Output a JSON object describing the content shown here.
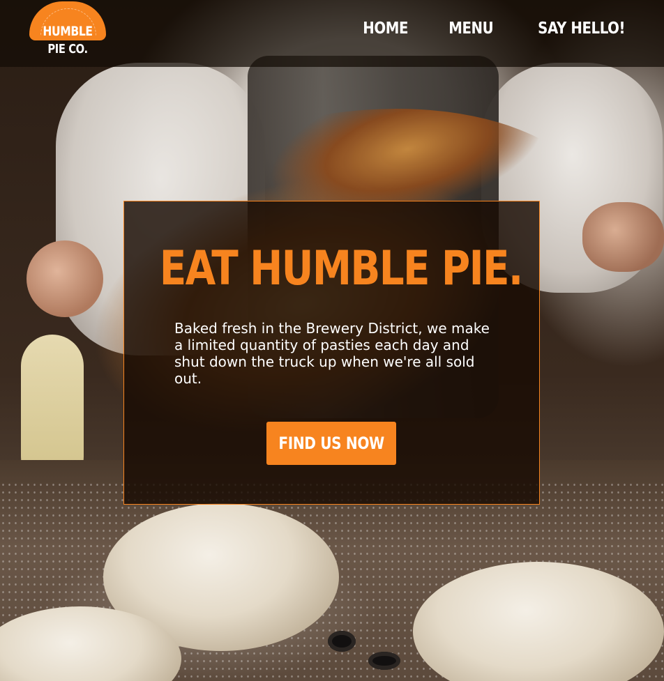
{
  "brand": {
    "logo_line1": "HUMBLE",
    "logo_line2": "PIE CO."
  },
  "nav": {
    "items": [
      {
        "label": "HOME"
      },
      {
        "label": "MENU"
      },
      {
        "label": "SAY HELLO!"
      }
    ]
  },
  "hero": {
    "title": "EAT HUMBLE PIE.",
    "description": "Baked fresh in the Brewery District, we make a limited quantity of pasties each day and shut down the truck up when we're all sold out.",
    "cta_label": "FIND US NOW"
  },
  "colors": {
    "accent": "#f7841f",
    "header_bg": "#140c06",
    "card_bg": "#180b02",
    "text": "#ffffff"
  },
  "icons": {
    "logo": "pie-badge-logo"
  }
}
